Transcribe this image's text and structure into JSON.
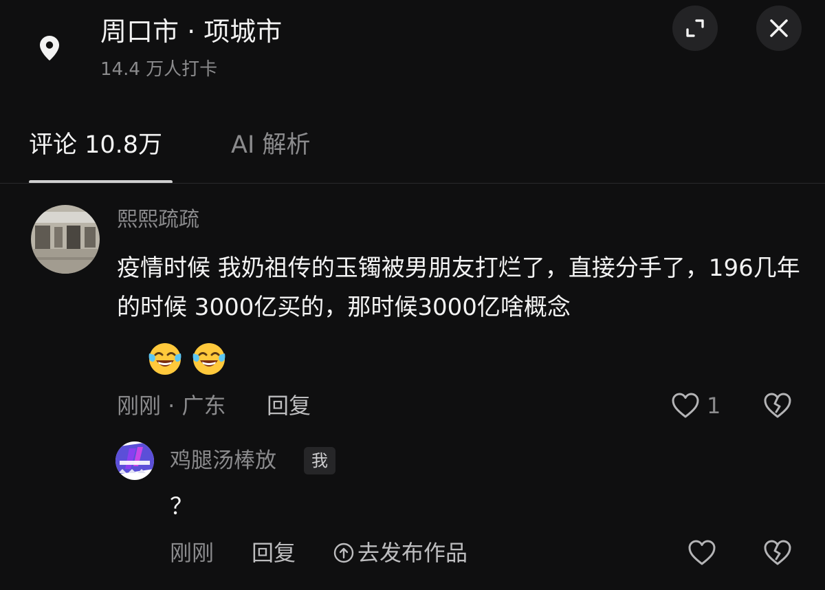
{
  "header": {
    "location_title": "周口市 · 项城市",
    "checkins": "14.4 万人打卡",
    "icons": {
      "location": "location-pin-icon",
      "expand": "expand-icon",
      "close": "close-icon"
    }
  },
  "tabs": [
    {
      "label": "评论 10.8万",
      "active": true
    },
    {
      "label": "AI 解析",
      "active": false
    }
  ],
  "comment": {
    "username": "熙熙疏疏",
    "text": "疫情时候 我奶祖传的玉镯被男朋友打烂了，直接分手了，196几年的时候  3000亿买的，那时候3000亿啥概念",
    "emojis": [
      "crying-laughing-emoji",
      "crying-laughing-emoji"
    ],
    "time_location": "刚刚 · 广东",
    "reply_label": "回复",
    "likes": "1"
  },
  "reply": {
    "username": "鸡腿汤棒放",
    "badge": "我",
    "text": "？",
    "time": "刚刚",
    "reply_label": "回复",
    "publish_label": "去发布作品"
  },
  "colors": {
    "background": "#0f0f10",
    "primary_text": "#f3f3f3",
    "secondary_text": "#8b8b8d",
    "emoji_yellow": "#ffc93c"
  }
}
